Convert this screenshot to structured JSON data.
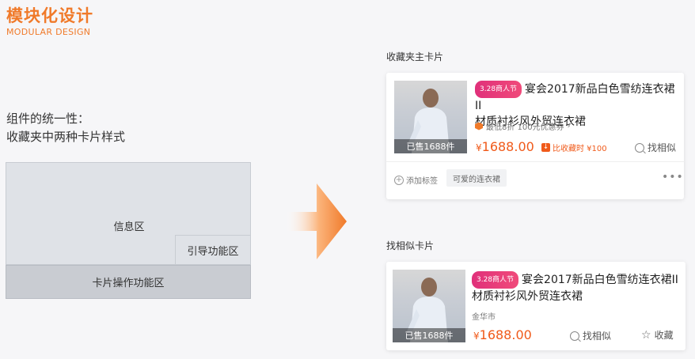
{
  "header": {
    "title": "模块化设计",
    "subtitle": "MODULAR DESIGN"
  },
  "description": {
    "line1": "组件的统一性：",
    "line2": "收藏夹中两种卡片样式"
  },
  "diagram": {
    "info_area": "信息区",
    "guide_area": "引导功能区",
    "action_area": "卡片操作功能区"
  },
  "main_card": {
    "section_label": "收藏夹主卡片",
    "badge": "3.28商人节",
    "title_line1": "宴会2017新品白色雪纺连衣裙II",
    "title_line2": "材质衬衫风外贸连衣裙",
    "sold": "已售1688件",
    "promo_text": "最低8折  100元优惠券",
    "promo_chevron": "›",
    "price_symbol": "¥",
    "price": "1688.00",
    "drop_icon": "↓",
    "drop_text": "比收藏时 ¥100",
    "find_similar": "找相似",
    "add_tag": "添加标签",
    "tag": "可爱的连衣裙",
    "more": "•••"
  },
  "similar_card": {
    "section_label": "找相似卡片",
    "badge": "3.28商人节",
    "title_line1": "宴会2017新品白色雪纺连衣裙II",
    "title_line2": "材质衬衫风外贸连衣裙",
    "sold": "已售1688件",
    "location": "金华市",
    "price_symbol": "¥",
    "price": "1688.00",
    "find_similar": "找相似",
    "favorite": "收藏",
    "star_icon": "☆"
  },
  "colors": {
    "accent": "#f07a2a",
    "price": "#f05a1a",
    "badge": "#e0307a"
  }
}
